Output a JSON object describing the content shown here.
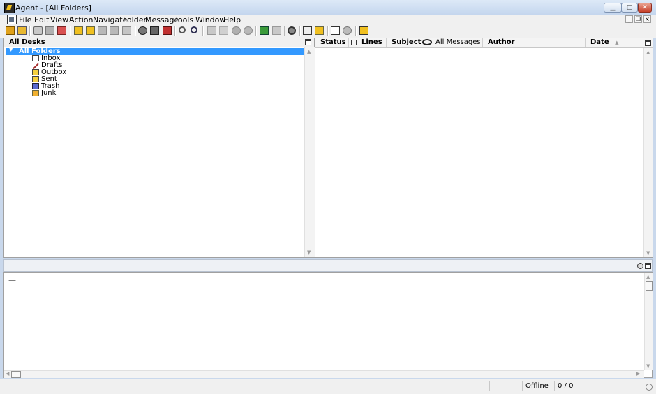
{
  "window": {
    "title": "Agent - [All Folders]"
  },
  "menu": [
    "File",
    "Edit",
    "View",
    "Action",
    "Navigate",
    "Folder",
    "Message",
    "Tools",
    "Window",
    "Help"
  ],
  "left_pane": {
    "title": "All Desks",
    "root": "All Folders",
    "folders": [
      "Inbox",
      "Drafts",
      "Outbox",
      "Sent",
      "Trash",
      "Junk"
    ]
  },
  "message_list": {
    "columns": {
      "status": "Status",
      "lines": "Lines",
      "subject": "Subject",
      "filter": "All Messages",
      "author": "Author",
      "date": "Date"
    }
  },
  "preview": {
    "text": "—"
  },
  "status_bar": {
    "mode": "Offline",
    "count": "0 / 0"
  },
  "colors": {
    "selection": "#3399ff",
    "title_bar": "#c4d6ee"
  },
  "icons": {
    "toolbar": [
      "new-post-icon",
      "reply-icon",
      "get-headers-icon",
      "get-bodies-icon",
      "mark-read-icon",
      "forward-icon",
      "redirect-icon",
      "next-icon",
      "next-unread-icon",
      "skip-icon",
      "sync-icon",
      "send-receive-icon",
      "purge-icon",
      "search-icon",
      "find-next-icon",
      "thread-down-icon",
      "cut-thread-icon",
      "watch-icon",
      "ignore-icon",
      "online-icon",
      "offline-icon",
      "options-icon",
      "windows-icon",
      "open-folder-icon",
      "layout-icon",
      "globe-icon",
      "help-icon"
    ]
  }
}
